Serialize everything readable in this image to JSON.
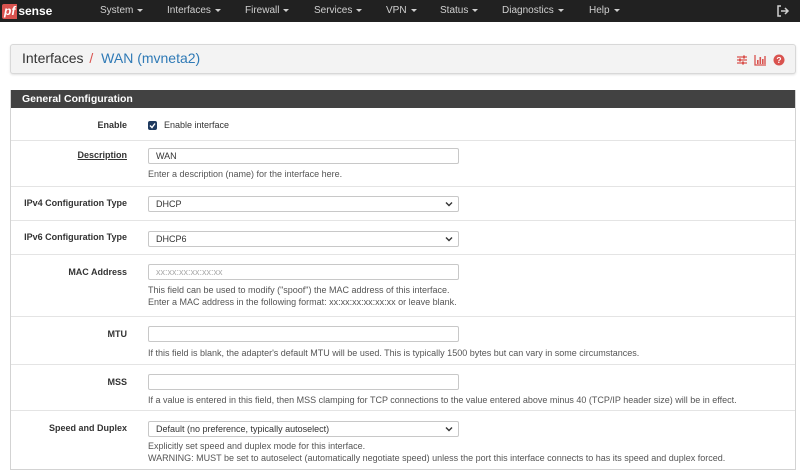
{
  "brand": {
    "pf": "pf",
    "sense": "sense"
  },
  "nav": {
    "items": [
      {
        "label": "System"
      },
      {
        "label": "Interfaces"
      },
      {
        "label": "Firewall"
      },
      {
        "label": "Services"
      },
      {
        "label": "VPN"
      },
      {
        "label": "Status"
      },
      {
        "label": "Diagnostics"
      },
      {
        "label": "Help"
      }
    ],
    "logout_icon": "logout-icon"
  },
  "breadcrumb": {
    "parent": "Interfaces",
    "separator": "/",
    "current": "WAN (mvneta2)",
    "icons": [
      "sliders-icon",
      "bar-chart-icon",
      "help-circle-icon"
    ]
  },
  "form": {
    "heading": "General Configuration",
    "enable": {
      "label": "Enable",
      "checked": true,
      "checkbox_label": "Enable interface"
    },
    "description": {
      "label": "Description",
      "value": "WAN",
      "help": "Enter a description (name) for the interface here."
    },
    "ipv4_type": {
      "label": "IPv4 Configuration Type",
      "value": "DHCP"
    },
    "ipv6_type": {
      "label": "IPv6 Configuration Type",
      "value": "DHCP6"
    },
    "mac": {
      "label": "MAC Address",
      "placeholder": "xx:xx:xx:xx:xx:xx",
      "help1": "This field can be used to modify (\"spoof\") the MAC address of this interface.",
      "help2": "Enter a MAC address in the following format: xx:xx:xx:xx:xx:xx or leave blank."
    },
    "mtu": {
      "label": "MTU",
      "value": "",
      "help": "If this field is blank, the adapter's default MTU will be used. This is typically 1500 bytes but can vary in some circumstances."
    },
    "mss": {
      "label": "MSS",
      "value": "",
      "help": "If a value is entered in this field, then MSS clamping for TCP connections to the value entered above minus 40 (TCP/IP header size) will be in effect."
    },
    "speed": {
      "label": "Speed and Duplex",
      "value": "Default (no preference, typically autoselect)",
      "help1": "Explicitly set speed and duplex mode for this interface.",
      "help2": "WARNING: MUST be set to autoselect (automatically negotiate speed) unless the port this interface connects to has its speed and duplex forced."
    }
  },
  "colors": {
    "navbar": "#212121",
    "brand_red": "#d9534f",
    "link_blue": "#2f7ab6",
    "panel_heading": "#424242",
    "checkbox": "#1f3a5f"
  }
}
